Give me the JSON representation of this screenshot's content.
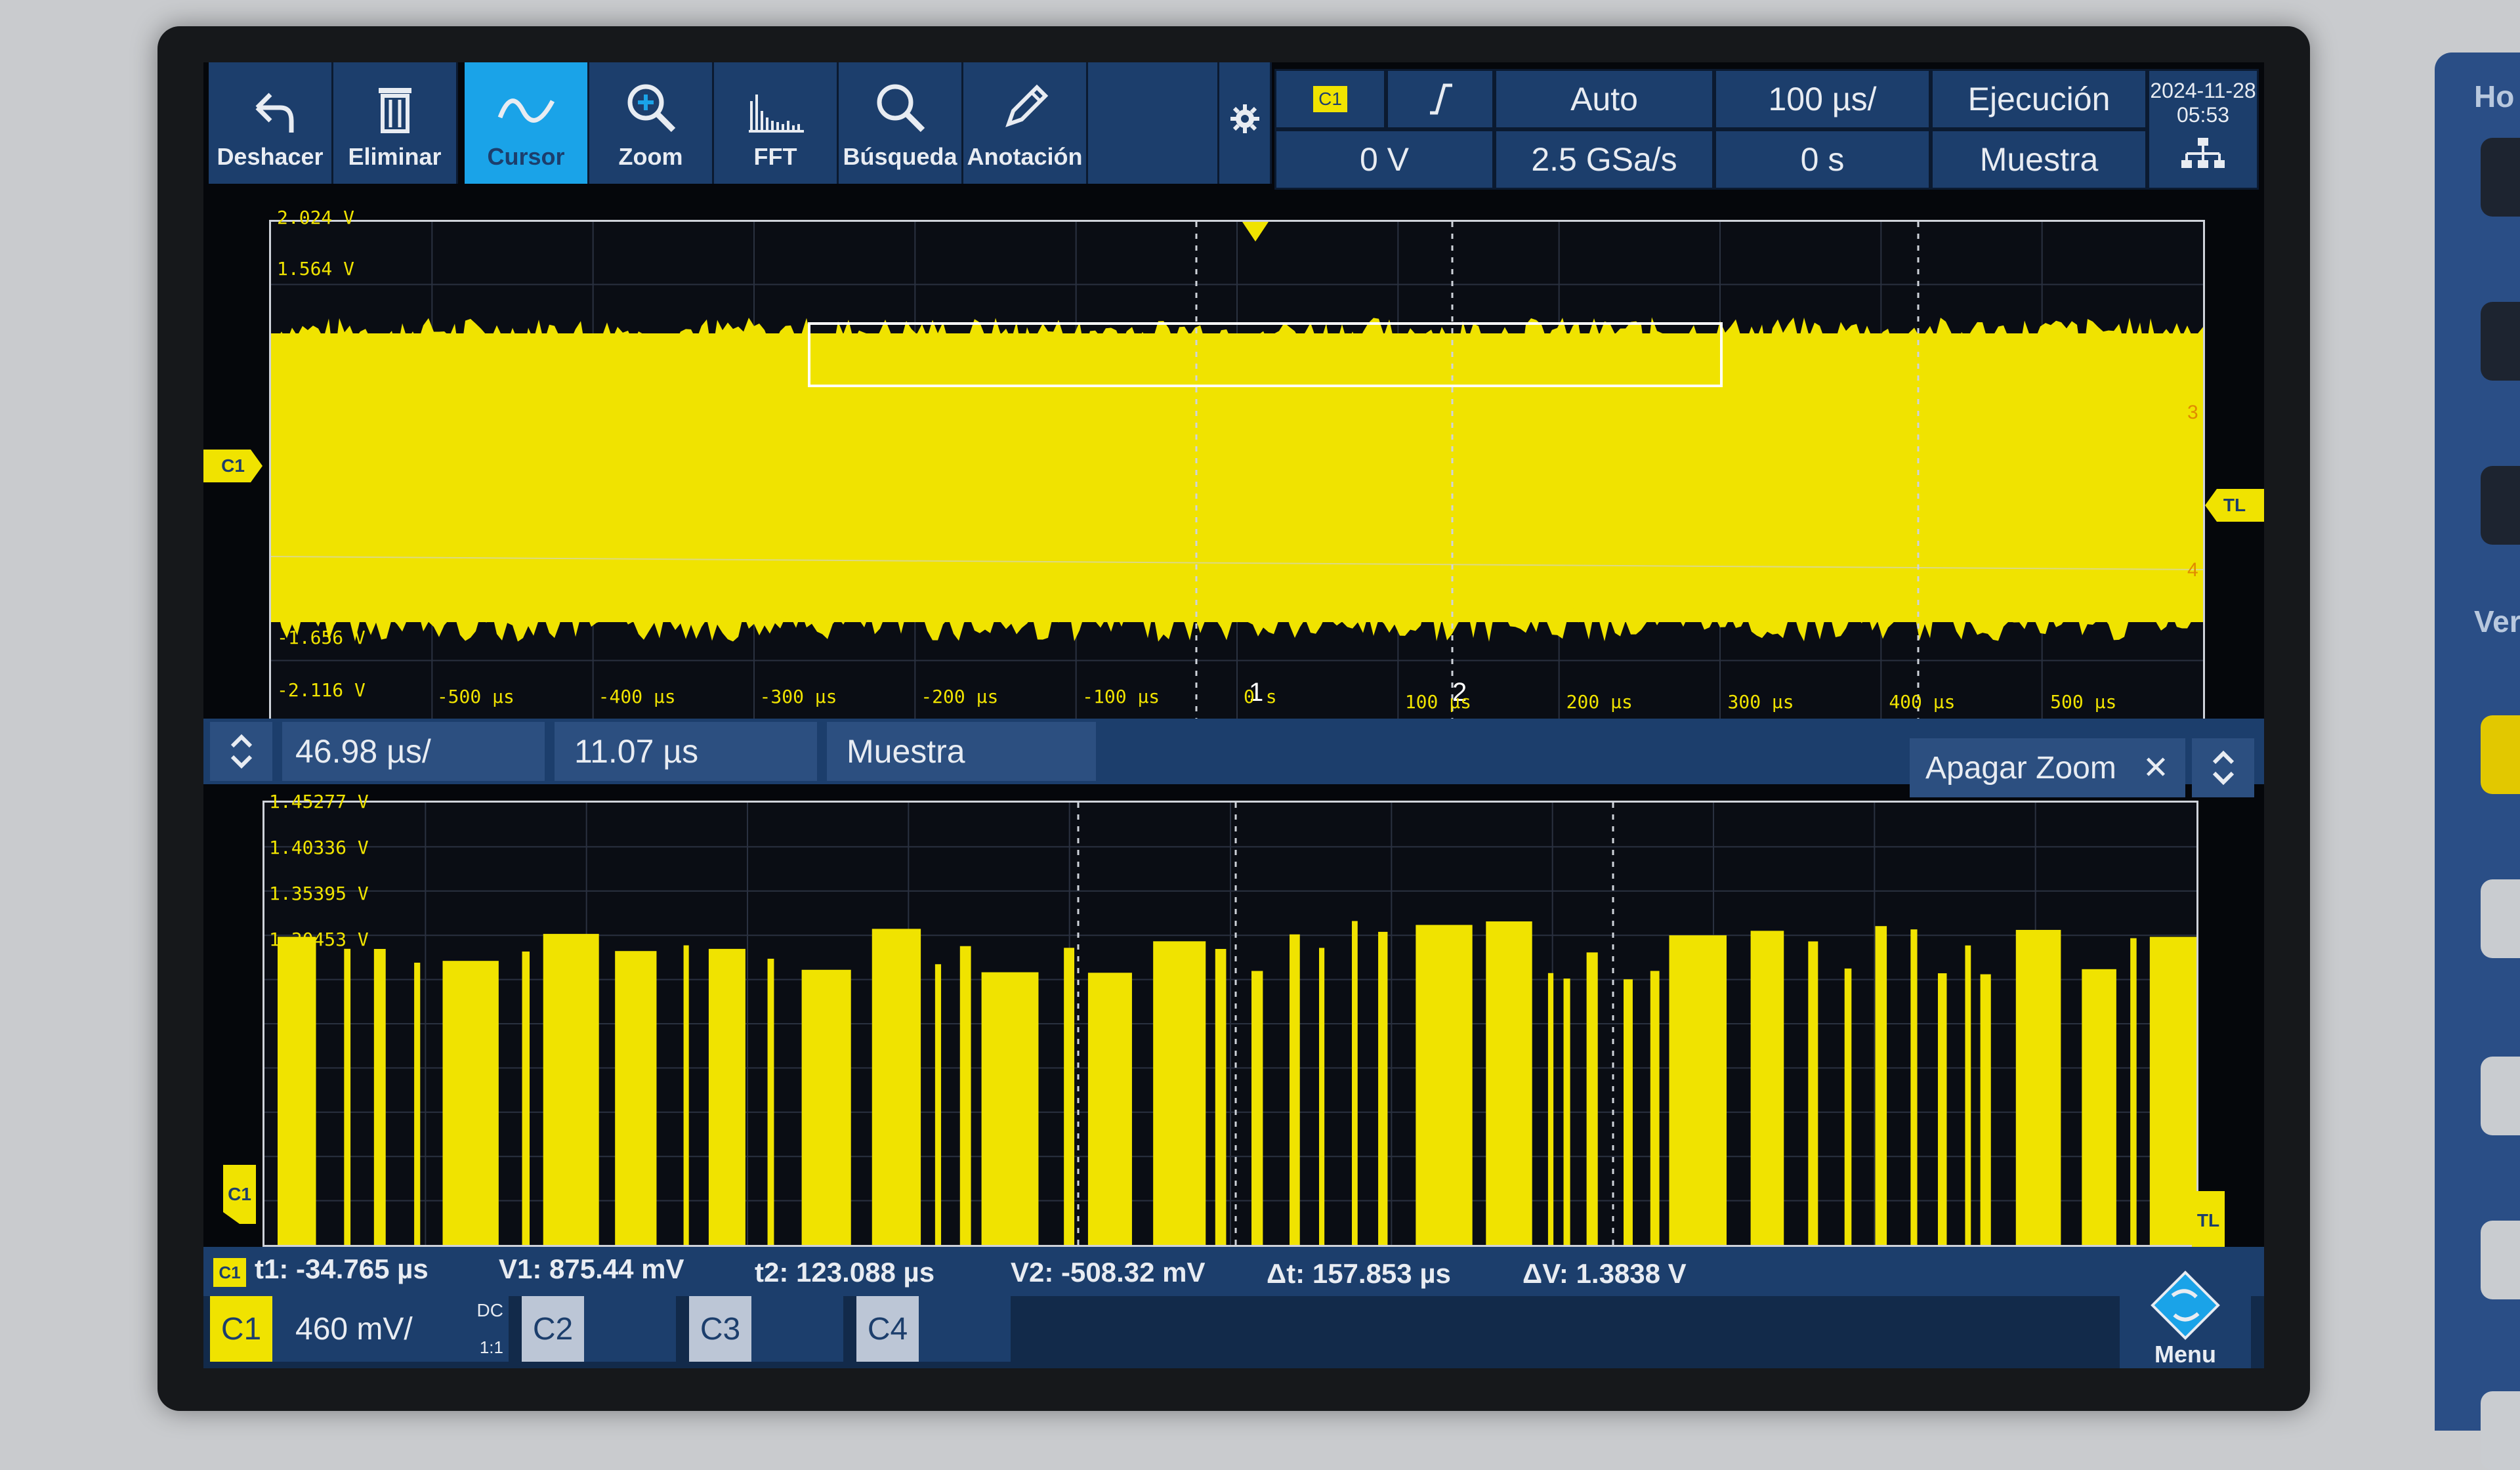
{
  "toolbar": {
    "undo": "Deshacer",
    "delete": "Eliminar",
    "cursor": "Cursor",
    "zoom": "Zoom",
    "fft": "FFT",
    "search": "Búsqueda",
    "annotation": "Anotación"
  },
  "trigger": {
    "source": "C1",
    "level": "0 V",
    "mode": "Auto",
    "sample_rate": "2.5 GSa/s",
    "time_scale": "100 µs/",
    "time_offset": "0 s",
    "run_state": "Ejecución",
    "acquisition": "Muestra",
    "date": "2024-11-28",
    "time": "05:53"
  },
  "main_plot": {
    "channel_label": "C1",
    "tl_label": "TL",
    "y_labels": [
      "2.024 V",
      "1.564 V",
      "-1.656 V",
      "-2.116 V"
    ],
    "x_labels": [
      "-500 µs",
      "-400 µs",
      "-300 µs",
      "-200 µs",
      "-100 µs",
      "0 s",
      "100 µs",
      "200 µs",
      "300 µs",
      "400 µs",
      "500 µs"
    ],
    "cursor1_label": "1",
    "cursor2_label": "2",
    "marker3": "3",
    "marker4": "4"
  },
  "zoom_bar": {
    "scale": "46.98 µs/",
    "position": "11.07 µs",
    "acquisition": "Muestra",
    "close": "Apagar Zoom",
    "close_glyph": "✕"
  },
  "zoom_plot": {
    "y_labels": [
      "1.45277 V",
      "1.40336 V",
      "1.35395 V",
      "1.30453 V"
    ],
    "channel_label": "C1",
    "tl_label": "TL"
  },
  "cursor_readout": {
    "channel": "C1",
    "t1": "t1: -34.765 µs",
    "v1": "V1: 875.44 mV",
    "t2": "t2: 123.088 µs",
    "v2": "V2: -508.32 mV",
    "dt": "Δt: 157.853 µs",
    "dv": "ΔV: 1.3838 V"
  },
  "channels": {
    "c1_label": "C1",
    "c1_scale": "460 mV/",
    "c1_coupling": "DC",
    "c1_ratio": "1:1",
    "c2_label": "C2",
    "c3_label": "C3",
    "c4_label": "C4",
    "menu": "Menu"
  },
  "side_panel": {
    "top": "Ho",
    "mid": "Vert"
  },
  "colors": {
    "trace": "#f0e300",
    "toolbar": "#1c3e6c",
    "active": "#1aa3e8"
  }
}
